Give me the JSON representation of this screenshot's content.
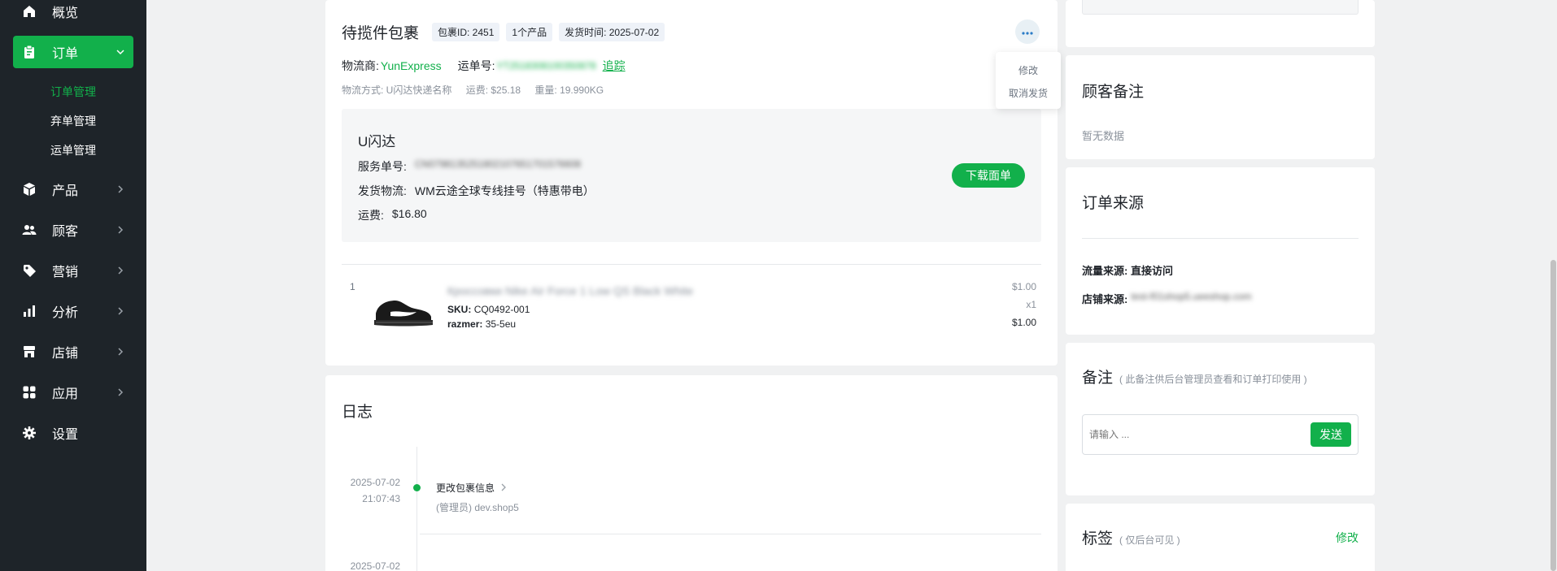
{
  "sidebar": {
    "items": [
      {
        "label": "概览",
        "icon": "home-icon"
      },
      {
        "label": "订单",
        "icon": "clipboard-icon"
      },
      {
        "label": "产品",
        "icon": "box-icon"
      },
      {
        "label": "顾客",
        "icon": "users-icon"
      },
      {
        "label": "营销",
        "icon": "tag-icon"
      },
      {
        "label": "分析",
        "icon": "bar-chart-icon"
      },
      {
        "label": "店铺",
        "icon": "store-icon"
      },
      {
        "label": "应用",
        "icon": "apps-icon"
      },
      {
        "label": "设置",
        "icon": "gear-icon"
      }
    ],
    "sub_items": [
      "订单管理",
      "弃单管理",
      "运单管理"
    ]
  },
  "package": {
    "title": "待揽件包裹",
    "tags": [
      "包裹ID: 2451",
      "1个产品",
      "发货时间: 2025-07-02"
    ],
    "carrier_label": "物流商:",
    "carrier_value": "YunExpress",
    "tracking_label": "运单号:",
    "tracking_value": "YT2518308100350878",
    "track_link": "追踪",
    "meta": {
      "method": "物流方式: U闪达快递名称",
      "freight": "运费: $25.18",
      "weight": "重量: 19.990KG"
    },
    "service": {
      "name": "U闪达",
      "service_no_label": "服务单号:",
      "service_no_value": "CN0798135251802107651701576608",
      "logistics_label": "发货物流:",
      "logistics_value": "WM云途全球专线挂号（特惠带电）",
      "fee_label": "运费:",
      "fee_value": "$16.80",
      "download_button": "下载面单"
    },
    "product": {
      "index": "1",
      "name": "Кроссовки Nike Air Force 1 Low QS Black White",
      "sku_label": "SKU:",
      "sku_value": "CQ0492-001",
      "attr_label": "razmer:",
      "attr_value": "35-5eu",
      "unit_price": "$1.00",
      "qty": "x1",
      "total": "$1.00"
    },
    "menu": [
      "修改",
      "取消发货"
    ]
  },
  "log": {
    "title": "日志",
    "entries": [
      {
        "date": "2025-07-02",
        "time": "21:07:43",
        "action": "更改包裹信息",
        "actor": "(管理员) dev.shop5"
      },
      {
        "date": "2025-07-02",
        "time": "",
        "action": "",
        "actor": ""
      }
    ]
  },
  "customer_note": {
    "title": "顾客备注",
    "empty": "暂无数据"
  },
  "order_source": {
    "title": "订单来源",
    "traffic_label": "流量来源:",
    "traffic_value": "直接访问",
    "store_label": "店铺来源:",
    "store_value": "test-f01shop5.ueeshop.com"
  },
  "remark": {
    "title": "备注",
    "subtitle": "( 此备注供后台管理员查看和订单打印使用 )",
    "placeholder": "请输入 ...",
    "send_button": "发送"
  },
  "tags_panel": {
    "title": "标签",
    "subtitle": "( 仅后台可见 )",
    "edit": "修改"
  },
  "colors": {
    "accent": "#12b04b",
    "sidebar_bg": "#1e2429",
    "page_bg": "#f0f1f2"
  }
}
